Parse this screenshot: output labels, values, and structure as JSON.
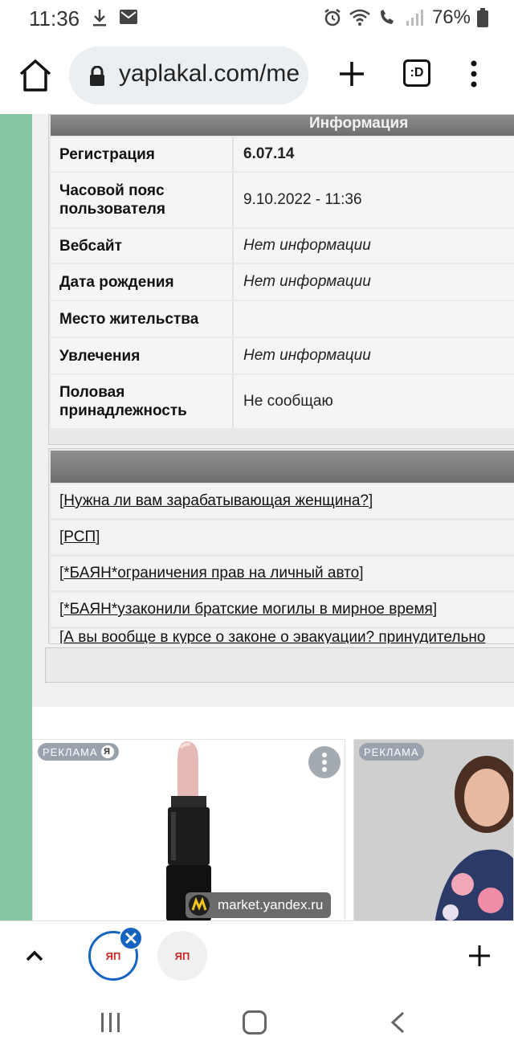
{
  "status_bar": {
    "time": "11:36",
    "battery": "76%"
  },
  "browser": {
    "url": "yaplakal.com/me",
    "tabs_switcher_label": ":D"
  },
  "info_table": {
    "header": "Информация",
    "rows": [
      {
        "label": "Регистрация",
        "value": "6.07.14",
        "style": "bold"
      },
      {
        "label": "Часовой пояс пользователя",
        "value": "9.10.2022 - 11:36",
        "style": "normal"
      },
      {
        "label": "Вебсайт",
        "value": "Нет информации",
        "style": "italic"
      },
      {
        "label": "Дата рождения",
        "value": "Нет информации",
        "style": "italic"
      },
      {
        "label": "Место жительства",
        "value": "",
        "style": "normal"
      },
      {
        "label": "Увлечения",
        "value": "Нет информации",
        "style": "italic"
      },
      {
        "label": "Половая принадлежность",
        "value": "Не сообщаю",
        "style": "normal"
      }
    ]
  },
  "topics": {
    "items": [
      "Нужна ли вам зарабатывающая женщина?",
      "РСП",
      "*БАЯН*ограничения прав на личный авто",
      "*БАЯН*узаконили братские могилы в мирное время",
      "А вы вообще в курсе о законе о эвакуации? принудительно"
    ],
    "bracket_open": "[ ",
    "bracket_close": " ]"
  },
  "ads": {
    "badge": "РЕКЛАМА",
    "badge_mark": "Я",
    "source": "market.yandex.ru"
  },
  "tabbar": {
    "tab_label": "ЯП"
  },
  "colors": {
    "accent_blue": "#1565c0",
    "side_strip_green": "#86c6a4",
    "header_gray": "#7a7a7a"
  }
}
